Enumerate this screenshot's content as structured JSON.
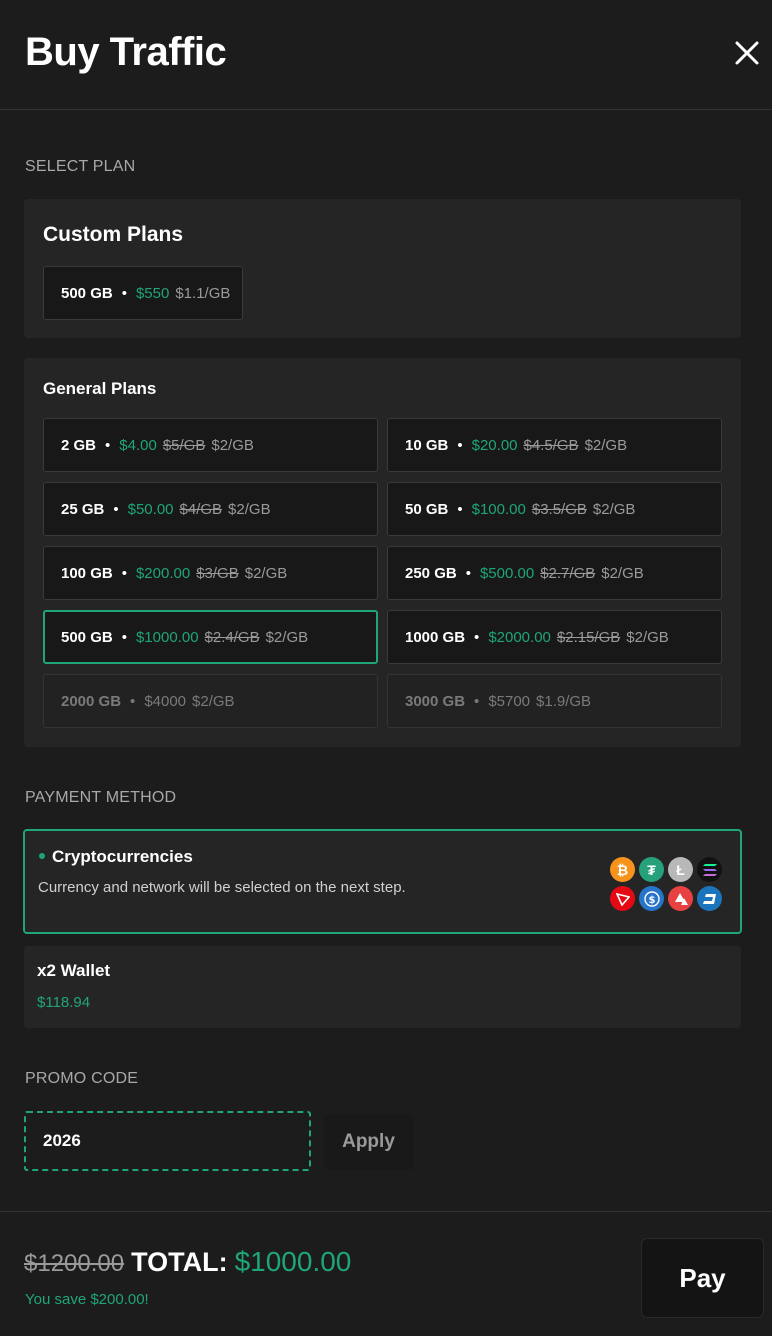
{
  "header": {
    "title": "Buy Traffic",
    "close_icon": "close-icon"
  },
  "select_plan": {
    "label": "SELECT PLAN",
    "custom": {
      "title": "Custom Plans",
      "plans": [
        {
          "gb": "500 GB",
          "price": "$550",
          "per": "$1.1/GB"
        }
      ]
    },
    "general": {
      "title": "General Plans",
      "plans": [
        {
          "gb": "2 GB",
          "price": "$4.00",
          "old": "$5/GB",
          "per": "$2/GB"
        },
        {
          "gb": "10 GB",
          "price": "$20.00",
          "old": "$4.5/GB",
          "per": "$2/GB"
        },
        {
          "gb": "25 GB",
          "price": "$50.00",
          "old": "$4/GB",
          "per": "$2/GB"
        },
        {
          "gb": "50 GB",
          "price": "$100.00",
          "old": "$3.5/GB",
          "per": "$2/GB"
        },
        {
          "gb": "100 GB",
          "price": "$200.00",
          "old": "$3/GB",
          "per": "$2/GB"
        },
        {
          "gb": "250 GB",
          "price": "$500.00",
          "old": "$2.7/GB",
          "per": "$2/GB"
        },
        {
          "gb": "500 GB",
          "price": "$1000.00",
          "old": "$2.4/GB",
          "per": "$2/GB",
          "selected": true
        },
        {
          "gb": "1000 GB",
          "price": "$2000.00",
          "old": "$2.15/GB",
          "per": "$2/GB"
        },
        {
          "gb": "2000 GB",
          "price": "$4000",
          "per": "$2/GB",
          "disabled": true
        },
        {
          "gb": "3000 GB",
          "price": "$5700",
          "per": "$1.9/GB",
          "disabled": true
        }
      ]
    }
  },
  "payment": {
    "label": "PAYMENT METHOD",
    "crypto": {
      "title": "Cryptocurrencies",
      "desc": "Currency and network will be selected on the next step.",
      "icons": [
        "bitcoin-icon",
        "tether-icon",
        "litecoin-icon",
        "solana-icon",
        "tron-icon",
        "usdc-icon",
        "avalanche-icon",
        "dash-icon"
      ]
    },
    "wallet": {
      "title": "x2 Wallet",
      "balance": "$118.94"
    }
  },
  "promo": {
    "label": "PROMO CODE",
    "value": "2026",
    "apply": "Apply"
  },
  "footer": {
    "old_total": "$1200.00",
    "total_label": "TOTAL:",
    "total": "$1000.00",
    "save": "You save $200.00!",
    "pay": "Pay"
  },
  "colors": {
    "accent": "#1fa57a",
    "bg": "#1c1c1c",
    "panel": "#252525"
  }
}
